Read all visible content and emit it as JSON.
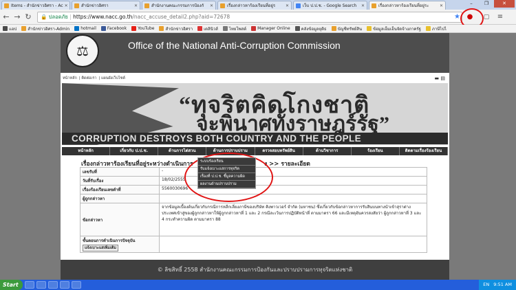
{
  "browser": {
    "tabs": [
      {
        "title": "Items - สำนักข่าวอิศรา - Ac",
        "active": false
      },
      {
        "title": "สำนักข่าวอิศรา",
        "active": false
      },
      {
        "title": "สำนักงานคณะกรรมการป้องกั",
        "active": false
      },
      {
        "title": "เรื่องกล่าวหาร้องเรียนที่อยู่ร",
        "active": false
      },
      {
        "title": "เว็บ ป.ป.ช. - Google Search",
        "active": false
      },
      {
        "title": "เรื่องกล่าวหาร้องเรียนที่อยู่ระ",
        "active": true
      }
    ],
    "window_controls": {
      "minimize": "–",
      "maximize": "❐",
      "close": "✕"
    },
    "secure_label": "ปลอดภัย",
    "url_host": "https://www.nacc.go.th",
    "url_path": "/nacc_accuse_detail2.php?aid=72678",
    "bookmarks": [
      "แอป",
      "สำนักข่าวอิศรา-Admin",
      "hotmail",
      "Facebook",
      "YouTube",
      "สำนักข่าวอิศรา",
      "เดลินิวส์",
      "ไทยโพสต์",
      "Manager Online",
      "คลังข้อมูลยุติธ",
      "บัญชีทรัพย์สิน",
      "ข้อมูลเอ็มเอ็นจัดจ้างภาครัฐ",
      "ภาษีไปไ"
    ]
  },
  "site": {
    "title": "Office of the National Anti-Corruption Commission",
    "seal_glyph": "⚖",
    "top_links": [
      "หน้าหลัก",
      "ติดต่อเรา",
      "แผนผังเว็บไซต์"
    ],
    "hero_line1": "“ทุจริตคิดโกงชาติ",
    "hero_line2": "จะพินาศทั้งราษฎร์รัฐ”",
    "slogan": "CORRUPTION DESTROYS BOTH COUNTRY AND THE PEOPLE",
    "nav": [
      "หน้าหลัก",
      "เกี่ยวกับ ป.ป.ช.",
      "ด้านการไต่สวน",
      "ด้านการปราบปราม",
      "ตรวจสอบทรัพย์สิน",
      "ด้านวิชาการ",
      "ร้องเรียน",
      "ติดตามเรื่องร้องเรียน"
    ],
    "dropdown": [
      "ระบบร้องเรียน",
      "รับแจ้งเบาะแสการทุจริต",
      "เรื่องที่ ป.ป.ช. ชี้มูลความผิด",
      "ผลงานด้านปราบปราม"
    ],
    "breadcrumb": "เรื่องกล่าวหาร้องเรียนที่อยู่ระหว่างดำเนินการ",
    "breadcrumb_tail": "ง >> รายละเอียด",
    "details": [
      {
        "label": "เลขรับที่",
        "value": "-"
      },
      {
        "label": "วันที่รับเรื่อง",
        "value": "18/02/2555"
      },
      {
        "label": "เรื่องร้องเรียนเลขดำที่",
        "value": "5560030696"
      },
      {
        "label": "ผู้ถูกกล่าวหา",
        "value": ""
      },
      {
        "label": "ข้อกล่าวหา",
        "value": "จากข้อมูลเบื้องต้นเกี่ยวกับกรณีการหลีกเลี่ยงภาษีของบริษัท คิงพาวเวอร์ จำกัด (มหาชน) ซึ่งเกี่ยวกับข้อกล่าวหาการรับสินบนทางนำเข้าสุราต่างประเทศเข้าสู่ของผู้ถูกกล่าวหาให้ผู้ถูกกล่าวหาที่ 1 และ 2 กรณีละเว้นการปฏิบัติหน้าที่ ตามมาตรา 66 และมีเหตุอันควรสงสัยว่า ผู้ถูกกล่าวหาที่ 3 และ 4 กระทำความผิด ตามมาตรา 88"
      },
      {
        "label": "ขั้นตอนการดำเนินการปัจจุบัน",
        "value": ""
      }
    ],
    "status_button": "แจ้งเบาะแสเพิ่มเติม",
    "footer": "© ลิขสิทธิ์ 2558 สำนักงานคณะกรรมการป้องกันและปราบปรามการทุจริตแห่งชาติ"
  },
  "taskbar": {
    "start": "Start",
    "lang": "EN",
    "time": "9:51 AM"
  },
  "colors": {
    "highlight_circle": "#e01515",
    "chrome_tabs": "#c6d5ec",
    "taskbar": "#245edb"
  }
}
